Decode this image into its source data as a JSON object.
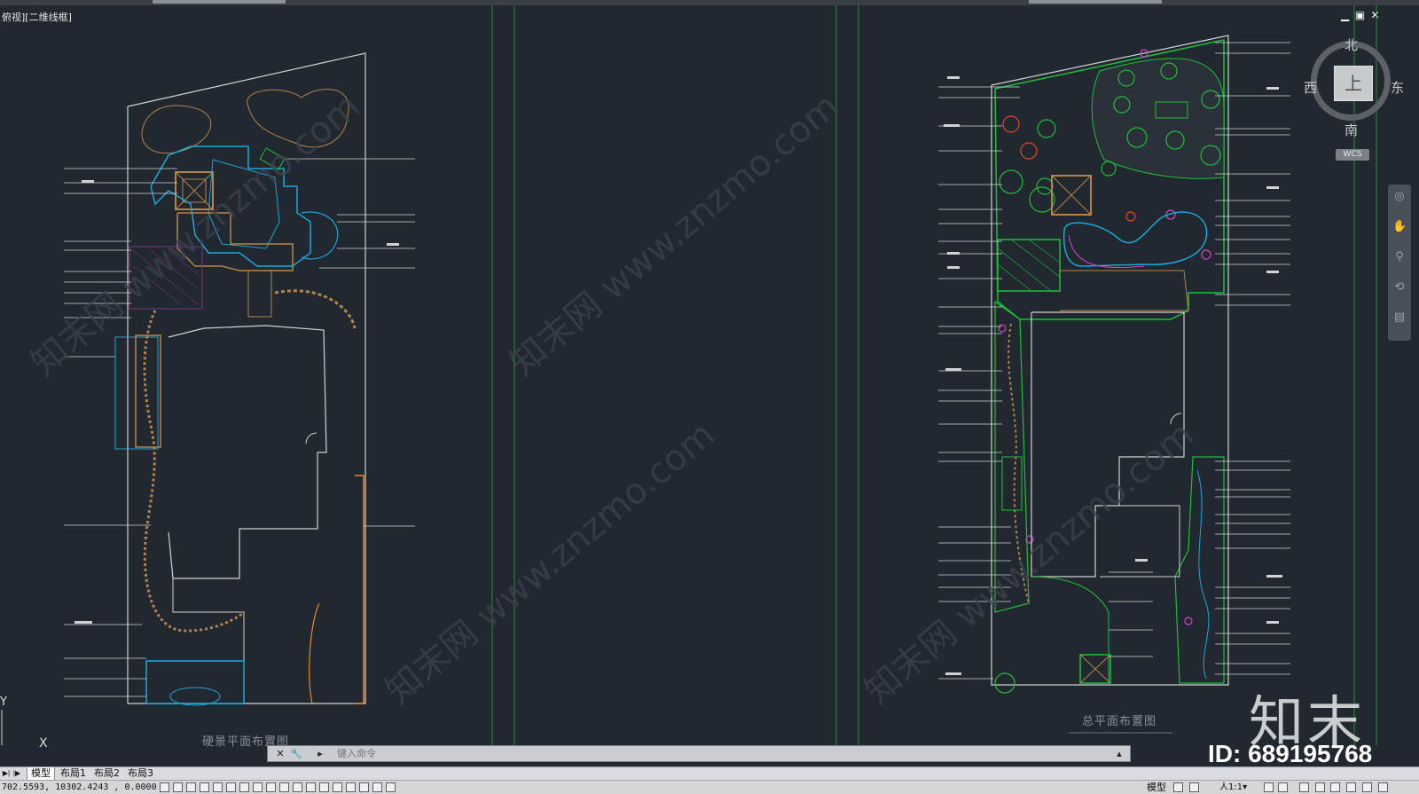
{
  "viewport": {
    "label": "俯视][二维线框]"
  },
  "window_controls": {
    "minimize": "▁",
    "restore": "▣",
    "close": "✕"
  },
  "drawings": {
    "left_title": "硬景平面布置图",
    "right_title": "总平面布置图"
  },
  "viewcube": {
    "north": "北",
    "south": "南",
    "west": "西",
    "east": "东",
    "top_face": "上",
    "wcs_label": "WCS"
  },
  "ucs": {
    "x_label": "X",
    "y_label": "Y"
  },
  "command_line": {
    "placeholder": "键入命令",
    "close_symbol": "✕",
    "customize_symbol": "🔧",
    "prompt_symbol": "▸"
  },
  "layout_tabs": {
    "tabs": [
      "模型",
      "布局1",
      "布局2",
      "布局3"
    ],
    "active": "模型"
  },
  "status_bar": {
    "coordinates": "702.5593, 10302.4243 , 0.0000",
    "model_label": "模型",
    "scale": "人1:1▾"
  },
  "watermark": {
    "logo_text": "知末",
    "id_text": "ID: 689195768",
    "site_text": "知末网 www.znzmo.com"
  },
  "colors": {
    "background": "#212830",
    "guide_green": "#2e8a3a",
    "boundary": "#d0d2d4",
    "water": "#1aa7d8",
    "wood": "#b8834a",
    "planting": "#1fbf3a",
    "accent_orange": "#e8892b"
  }
}
